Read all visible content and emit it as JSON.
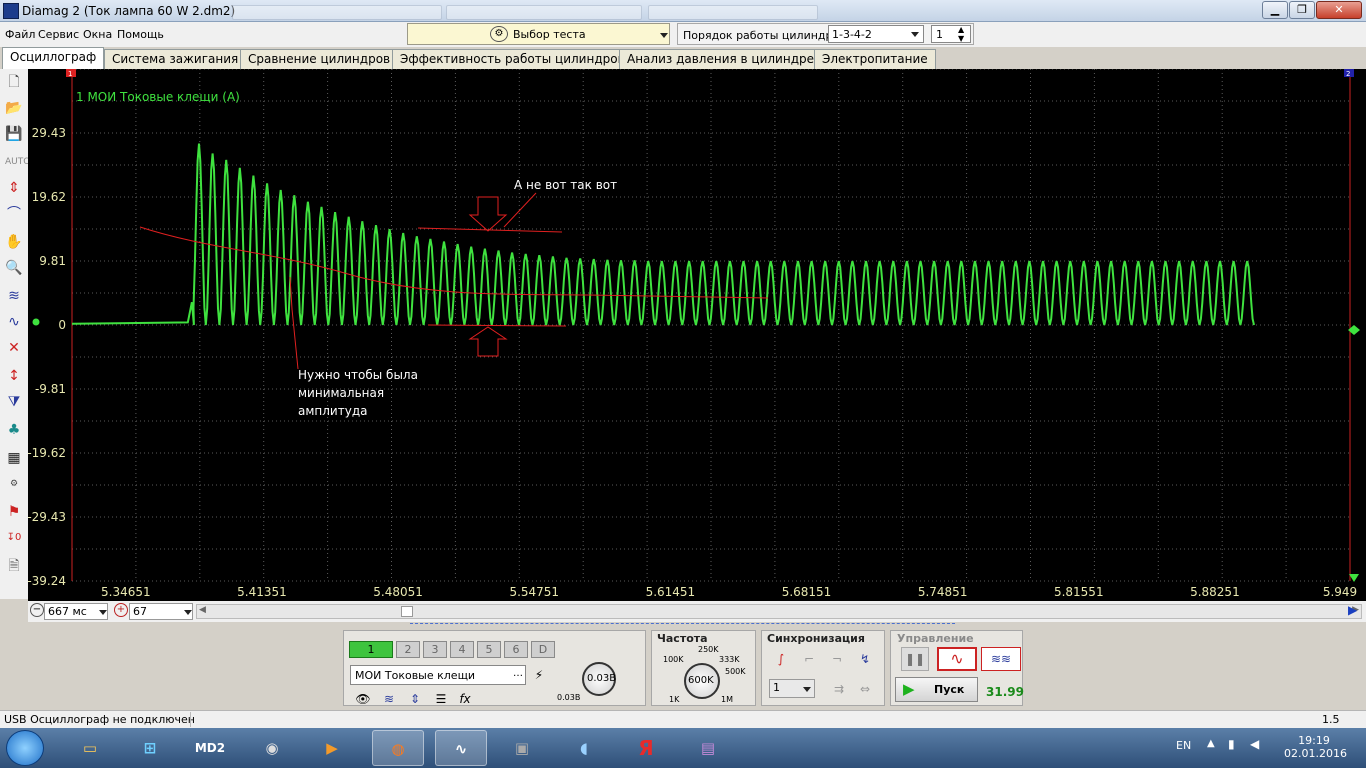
{
  "window": {
    "title": "Diamag 2 (Ток лампа 60 W 2.dm2)"
  },
  "menu": [
    "Файл",
    "Сервис",
    "Окна",
    "Помощь"
  ],
  "toolbar": {
    "test_select": "Выбор теста",
    "cyl_order_label": "Порядок работы цилиндров",
    "cyl_order_value": "1-3-4-2",
    "cyl_number": "1"
  },
  "tabs": [
    "Осциллограф",
    "Система зажигания",
    "Сравнение цилиндров",
    "Эффективность работы цилиндров",
    "Анализ давления в цилиндре",
    "Электропитание"
  ],
  "active_tab": 0,
  "plot": {
    "channel_label": "1 МОИ Токовые клещи  (A)",
    "y_ticks": [
      "29.43",
      "19.62",
      "9.81",
      "0",
      "-9.81",
      "-19.62",
      "-29.43",
      "-39.24"
    ],
    "x_ticks": [
      "5.34651",
      "5.41351",
      "5.48051",
      "5.54751",
      "5.61451",
      "5.68151",
      "5.74851",
      "5.81551",
      "5.88251",
      "5.949"
    ],
    "annotation_top": "А не вот так вот",
    "annotation_bottom": [
      "Нужно чтобы была",
      "минимальная",
      "амплитуда"
    ],
    "marker_left": "1",
    "marker_right": "2",
    "colors": {
      "trace": "#3fe23f",
      "annotation": "#e02020",
      "grid": "#5a5a5a"
    }
  },
  "chart_data": {
    "type": "line",
    "title": "",
    "ylabel": "1 МОИ Токовые клещи  (A)",
    "xlabel": "",
    "xlim": [
      5.32,
      5.949
    ],
    "ylim": [
      -39.24,
      39.24
    ],
    "grid": true,
    "series": [
      {
        "name": "1 МОИ Токовые клещи  (A)",
        "x_start": 5.38,
        "period": 0.0067,
        "peak_x": [
          5.3825,
          5.3892,
          5.3959,
          5.4026,
          5.4093,
          5.416,
          5.4227,
          5.4294,
          5.4361,
          5.4428,
          5.4495,
          5.4562,
          5.4629,
          5.4696,
          5.4763,
          5.483,
          5.4897,
          5.4964,
          5.5031,
          5.5098,
          5.5165,
          5.5232,
          5.5299,
          5.5366,
          5.5433,
          5.55,
          5.5567,
          5.5634,
          5.5701,
          5.5768,
          5.5835,
          5.5902,
          5.5969,
          5.6036,
          5.6103,
          5.617,
          5.6237,
          5.6304,
          5.6371,
          5.6438,
          5.6505,
          5.6572,
          5.6639,
          5.6706,
          5.6773,
          5.684,
          5.6907,
          5.6974,
          5.7041,
          5.7108,
          5.7175,
          5.7242,
          5.7309,
          5.7376,
          5.7443,
          5.751,
          5.7577,
          5.7644,
          5.7711,
          5.7778,
          5.7845,
          5.7912,
          5.7979,
          5.8046,
          5.8113,
          5.818,
          5.8247,
          5.8314,
          5.8381,
          5.8448,
          5.8515,
          5.8582,
          5.8649,
          5.8716,
          5.8783,
          5.885,
          5.8917,
          5.8984
        ],
        "peak_y": [
          27.8,
          26.3,
          25.3,
          24.1,
          22.9,
          21.7,
          20.7,
          19.9,
          18.9,
          18.1,
          17.3,
          16.6,
          15.9,
          15.3,
          14.7,
          14.1,
          13.6,
          13.2,
          12.8,
          12.4,
          12.0,
          11.7,
          11.4,
          11.1,
          10.9,
          10.7,
          10.5,
          10.3,
          10.2,
          10.1,
          10.0,
          9.9,
          9.9,
          9.8,
          9.8,
          9.8,
          9.8,
          9.8,
          9.8,
          9.8,
          9.8,
          9.8,
          9.8,
          9.8,
          9.8,
          9.8,
          9.8,
          9.8,
          9.8,
          9.8,
          9.8,
          9.8,
          9.8,
          9.8,
          9.8,
          9.8,
          9.8,
          9.8,
          9.8,
          9.8,
          9.8,
          9.8,
          9.8,
          9.8,
          9.8,
          9.8,
          9.8,
          9.8,
          9.8,
          9.8,
          9.8,
          9.8,
          9.8,
          9.8,
          9.8,
          9.8,
          9.8,
          9.8
        ],
        "trough_y": 0
      }
    ],
    "annotations": [
      {
        "text": "А не вот так вот",
        "x": 5.5,
        "y": 21.5
      },
      {
        "text": "Нужно чтобы была минимальная амплитуда",
        "x": 5.405,
        "y": -8.5
      }
    ]
  },
  "timebase": {
    "left_value": "667 мс",
    "right_value": "67"
  },
  "channels": {
    "buttons": [
      "1",
      "2",
      "3",
      "4",
      "5",
      "6",
      "D"
    ],
    "active": "1",
    "sensor": "МОИ Токовые клещи",
    "volts": "0.03В",
    "volts_small": "0.03В"
  },
  "frequency": {
    "title": "Частота",
    "labels": [
      "100K",
      "250K",
      "333K",
      "500K",
      "1K",
      "1M"
    ],
    "value": "600K"
  },
  "sync": {
    "title": "Синхронизация",
    "channel": "1"
  },
  "control": {
    "title": "Управление",
    "start": "Пуск",
    "fps": "31.99"
  },
  "status": {
    "text": "USB Осциллограф не подключен",
    "scale": "1.5"
  },
  "taskbar": {
    "lang": "EN",
    "time": "19:19",
    "date": "02.01.2016"
  }
}
